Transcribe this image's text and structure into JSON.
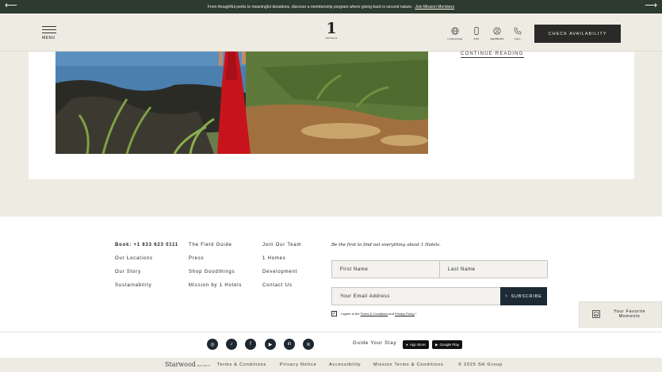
{
  "announcement": {
    "text": "From thoughtful perks to meaningful donations, discover a membership program where giving back is second nature.",
    "link": "Join Mission Members",
    "prev_arrow": "⟵",
    "next_arrow": "⟶"
  },
  "header": {
    "menu_label": "MENU",
    "logo_number": "1",
    "logo_sub": "HOTELS",
    "icons": [
      {
        "name": "globe-icon",
        "label": "LANGUAGE"
      },
      {
        "name": "phone-app-icon",
        "label": "APP"
      },
      {
        "name": "user-icon",
        "label": "MEMBERS"
      },
      {
        "name": "call-icon",
        "label": "CALL"
      }
    ],
    "cta": "CHECK AVAILABILITY"
  },
  "card": {
    "continue_label": "CONTINUE READING"
  },
  "footer": {
    "col1": [
      "Book: +1 833 623 0111",
      "Our Locations",
      "Our Story",
      "Sustainability"
    ],
    "col2": [
      "The Field Guide",
      "Press",
      "Shop Goodthings",
      "Mission by 1 Hotels"
    ],
    "col3": [
      "Join Our Team",
      "1 Homes",
      "Development",
      "Contact Us"
    ],
    "newsletter": {
      "title": "Be the first to find out everything about 1 Hotels.",
      "first_name": "First Name",
      "last_name": "Last Name",
      "email": "Your Email Address",
      "subscribe": "SUBSCRIBE",
      "subscribe_arrow": "›",
      "agree_prefix": "I agree to the",
      "terms_link": "Terms & Conditions",
      "agree_and": "and",
      "privacy_link": "Privacy Policy",
      "agree_suffix": "*",
      "checkmark": "✓"
    },
    "social": [
      {
        "name": "instagram-icon",
        "glyph": "◎"
      },
      {
        "name": "tiktok-icon",
        "glyph": "♪"
      },
      {
        "name": "facebook-icon",
        "glyph": "f"
      },
      {
        "name": "youtube-icon",
        "glyph": "▶"
      },
      {
        "name": "linkedin-icon",
        "glyph": "in"
      },
      {
        "name": "spotify-icon",
        "glyph": "≋"
      }
    ],
    "guide_label": "Guide Your Stay",
    "app_store": "App Store",
    "google_play": "Google Play"
  },
  "favorites": {
    "line1": "Your Favorite",
    "line2": "Moments"
  },
  "bottom": {
    "brand": "Starwood",
    "brand_sub": "HOTELS",
    "links": [
      "Terms & Conditions",
      "Privacy Notice",
      "Accessibility",
      "Mission Terms & Conditions"
    ],
    "copyright": "© 2025 SH Group"
  }
}
